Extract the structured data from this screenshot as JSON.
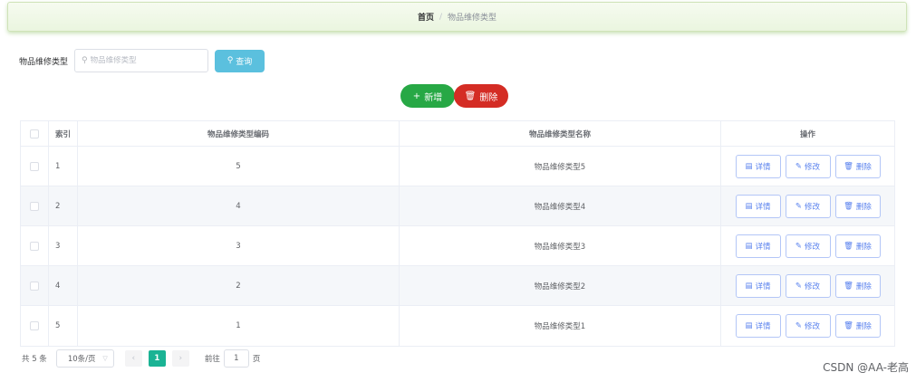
{
  "breadcrumb": {
    "home": "首页",
    "separator": "/",
    "current": "物品维修类型"
  },
  "search": {
    "label": "物品维修类型",
    "placeholder": "物品维修类型",
    "value": "",
    "button": "查询"
  },
  "actions": {
    "add": "新增",
    "delete": "删除"
  },
  "table": {
    "headers": {
      "index": "索引",
      "code": "物品维修类型编码",
      "name": "物品维修类型名称",
      "ops": "操作"
    },
    "rows": [
      {
        "index": "1",
        "code": "5",
        "name": "物品维修类型5"
      },
      {
        "index": "2",
        "code": "4",
        "name": "物品维修类型4"
      },
      {
        "index": "3",
        "code": "3",
        "name": "物品维修类型3"
      },
      {
        "index": "4",
        "code": "2",
        "name": "物品维修类型2"
      },
      {
        "index": "5",
        "code": "1",
        "name": "物品维修类型1"
      }
    ],
    "row_actions": {
      "detail": "详情",
      "edit": "修改",
      "delete": "删除"
    }
  },
  "pagination": {
    "total": "共 5 条",
    "page_size": "10条/页",
    "current_page": "1",
    "goto_prefix": "前往",
    "goto_value": "1",
    "goto_suffix": "页"
  },
  "watermark": "CSDN @AA-老高",
  "colors": {
    "search_button": "#5bc0de",
    "add_button": "#27a845",
    "delete_button": "#d42c24",
    "active_page": "#1ab394",
    "op_button": "#5a82ee"
  }
}
